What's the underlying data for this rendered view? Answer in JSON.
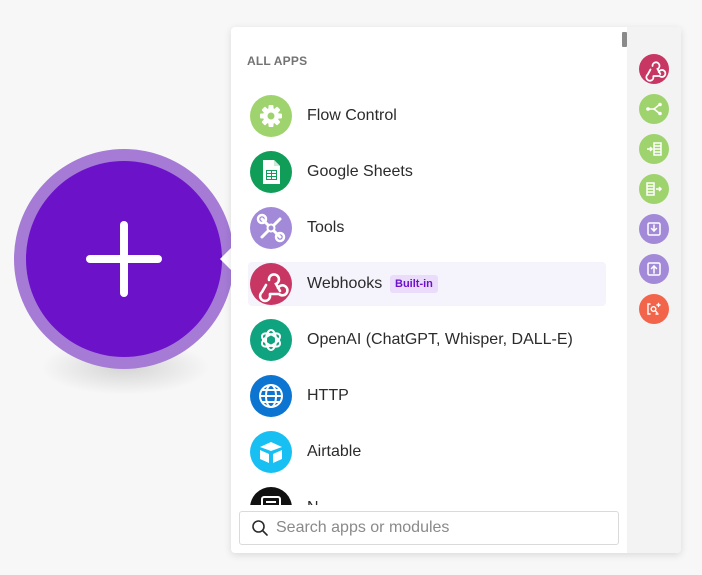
{
  "panel": {
    "section_title": "ALL APPS",
    "apps": [
      {
        "label": "Flow Control",
        "icon": "gear-icon",
        "color": "#9fd36e"
      },
      {
        "label": "Google Sheets",
        "icon": "spreadsheet-icon",
        "color": "#0f9d58"
      },
      {
        "label": "Tools",
        "icon": "wrench-icon",
        "color": "#a28ad8"
      },
      {
        "label": "Webhooks",
        "icon": "webhook-icon",
        "color": "#c83663",
        "badge": "Built-in",
        "selected": true
      },
      {
        "label": "OpenAI (ChatGPT, Whisper, DALL-E)",
        "icon": "openai-icon",
        "color": "#10a37f"
      },
      {
        "label": "HTTP",
        "icon": "globe-icon",
        "color": "#0b75d1"
      },
      {
        "label": "Airtable",
        "icon": "airtable-icon",
        "color": "#18bff2"
      },
      {
        "label": "N",
        "icon": "notion-icon",
        "color": "#111111"
      }
    ],
    "search_placeholder": "Search apps or modules"
  },
  "side_strip": [
    {
      "icon": "webhook-icon",
      "color": "#c83663"
    },
    {
      "icon": "router-icon",
      "color": "#9fd36e"
    },
    {
      "icon": "iterator-icon",
      "color": "#9fd36e"
    },
    {
      "icon": "aggregator-icon",
      "color": "#9fd36e"
    },
    {
      "icon": "import-icon",
      "color": "#a28ad8"
    },
    {
      "icon": "export-icon",
      "color": "#a28ad8"
    },
    {
      "icon": "ai-search-icon",
      "color": "#f2654a"
    }
  ],
  "colors": {
    "add_button_core": "#6c12c9",
    "add_button_ring": "#a57bd6",
    "badge_text": "#6d12c9",
    "badge_bg": "#ecdcfb"
  }
}
